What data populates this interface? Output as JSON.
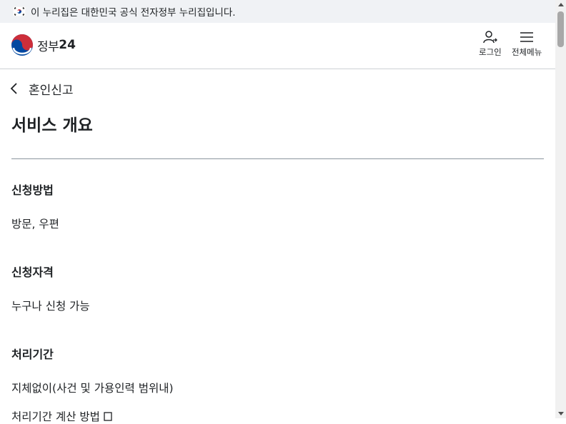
{
  "banner": {
    "text": "이 누리집은 대한민국 공식 전자정부 누리집입니다."
  },
  "header": {
    "logo_text": "정부",
    "logo_num": "24",
    "login_label": "로그인",
    "menu_label": "전체메뉴"
  },
  "nav": {
    "back_title": "혼인신고"
  },
  "main": {
    "title": "서비스 개요",
    "sections": [
      {
        "heading": "신청방법",
        "value": "방문, 우편"
      },
      {
        "heading": "신청자격",
        "value": "누구나 신청 가능"
      },
      {
        "heading": "처리기간",
        "value": "지체없이(사건 및 가용인력 범위내)"
      }
    ],
    "calc_link": "처리기간 계산 방법"
  },
  "colors": {
    "brand_red": "#cd2e3a",
    "brand_blue": "#0047a0",
    "text": "#1e2124"
  }
}
